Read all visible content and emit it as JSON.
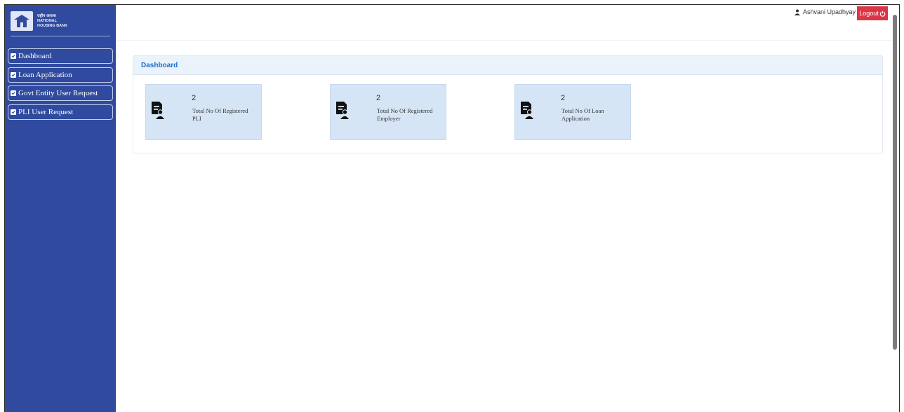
{
  "logo": {
    "line1": "राष्ट्रीय आवास",
    "line2": "NATIONAL",
    "line3": "HOUSING BANK"
  },
  "sidebar": {
    "items": [
      {
        "label": "Dashboard"
      },
      {
        "label": "Loan Application"
      },
      {
        "label": "Govt Entity User Request"
      },
      {
        "label": "PLI User Request"
      }
    ]
  },
  "header": {
    "user_name": "Ashvani Upadhyay",
    "logout_label": "Logout"
  },
  "panel": {
    "title": "Dashboard"
  },
  "cards": [
    {
      "count": "2",
      "label": "Total No Of Registered PLI"
    },
    {
      "count": "2",
      "label": "Total No Of Registered Employer"
    },
    {
      "count": "2",
      "label": "Total No Of Loan Application"
    }
  ],
  "colors": {
    "sidebar": "#2f4a9e",
    "logout": "#dc3545",
    "accent": "#1c6fd1",
    "card": "#d6e5f5"
  }
}
